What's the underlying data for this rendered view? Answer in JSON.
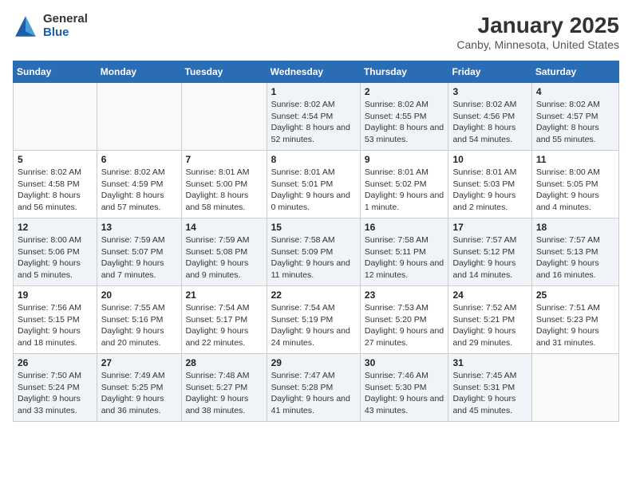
{
  "logo": {
    "general": "General",
    "blue": "Blue"
  },
  "title": "January 2025",
  "subtitle": "Canby, Minnesota, United States",
  "headers": [
    "Sunday",
    "Monday",
    "Tuesday",
    "Wednesday",
    "Thursday",
    "Friday",
    "Saturday"
  ],
  "weeks": [
    [
      {
        "day": "",
        "content": ""
      },
      {
        "day": "",
        "content": ""
      },
      {
        "day": "",
        "content": ""
      },
      {
        "day": "1",
        "content": "Sunrise: 8:02 AM\nSunset: 4:54 PM\nDaylight: 8 hours and 52 minutes."
      },
      {
        "day": "2",
        "content": "Sunrise: 8:02 AM\nSunset: 4:55 PM\nDaylight: 8 hours and 53 minutes."
      },
      {
        "day": "3",
        "content": "Sunrise: 8:02 AM\nSunset: 4:56 PM\nDaylight: 8 hours and 54 minutes."
      },
      {
        "day": "4",
        "content": "Sunrise: 8:02 AM\nSunset: 4:57 PM\nDaylight: 8 hours and 55 minutes."
      }
    ],
    [
      {
        "day": "5",
        "content": "Sunrise: 8:02 AM\nSunset: 4:58 PM\nDaylight: 8 hours and 56 minutes."
      },
      {
        "day": "6",
        "content": "Sunrise: 8:02 AM\nSunset: 4:59 PM\nDaylight: 8 hours and 57 minutes."
      },
      {
        "day": "7",
        "content": "Sunrise: 8:01 AM\nSunset: 5:00 PM\nDaylight: 8 hours and 58 minutes."
      },
      {
        "day": "8",
        "content": "Sunrise: 8:01 AM\nSunset: 5:01 PM\nDaylight: 9 hours and 0 minutes."
      },
      {
        "day": "9",
        "content": "Sunrise: 8:01 AM\nSunset: 5:02 PM\nDaylight: 9 hours and 1 minute."
      },
      {
        "day": "10",
        "content": "Sunrise: 8:01 AM\nSunset: 5:03 PM\nDaylight: 9 hours and 2 minutes."
      },
      {
        "day": "11",
        "content": "Sunrise: 8:00 AM\nSunset: 5:05 PM\nDaylight: 9 hours and 4 minutes."
      }
    ],
    [
      {
        "day": "12",
        "content": "Sunrise: 8:00 AM\nSunset: 5:06 PM\nDaylight: 9 hours and 5 minutes."
      },
      {
        "day": "13",
        "content": "Sunrise: 7:59 AM\nSunset: 5:07 PM\nDaylight: 9 hours and 7 minutes."
      },
      {
        "day": "14",
        "content": "Sunrise: 7:59 AM\nSunset: 5:08 PM\nDaylight: 9 hours and 9 minutes."
      },
      {
        "day": "15",
        "content": "Sunrise: 7:58 AM\nSunset: 5:09 PM\nDaylight: 9 hours and 11 minutes."
      },
      {
        "day": "16",
        "content": "Sunrise: 7:58 AM\nSunset: 5:11 PM\nDaylight: 9 hours and 12 minutes."
      },
      {
        "day": "17",
        "content": "Sunrise: 7:57 AM\nSunset: 5:12 PM\nDaylight: 9 hours and 14 minutes."
      },
      {
        "day": "18",
        "content": "Sunrise: 7:57 AM\nSunset: 5:13 PM\nDaylight: 9 hours and 16 minutes."
      }
    ],
    [
      {
        "day": "19",
        "content": "Sunrise: 7:56 AM\nSunset: 5:15 PM\nDaylight: 9 hours and 18 minutes."
      },
      {
        "day": "20",
        "content": "Sunrise: 7:55 AM\nSunset: 5:16 PM\nDaylight: 9 hours and 20 minutes."
      },
      {
        "day": "21",
        "content": "Sunrise: 7:54 AM\nSunset: 5:17 PM\nDaylight: 9 hours and 22 minutes."
      },
      {
        "day": "22",
        "content": "Sunrise: 7:54 AM\nSunset: 5:19 PM\nDaylight: 9 hours and 24 minutes."
      },
      {
        "day": "23",
        "content": "Sunrise: 7:53 AM\nSunset: 5:20 PM\nDaylight: 9 hours and 27 minutes."
      },
      {
        "day": "24",
        "content": "Sunrise: 7:52 AM\nSunset: 5:21 PM\nDaylight: 9 hours and 29 minutes."
      },
      {
        "day": "25",
        "content": "Sunrise: 7:51 AM\nSunset: 5:23 PM\nDaylight: 9 hours and 31 minutes."
      }
    ],
    [
      {
        "day": "26",
        "content": "Sunrise: 7:50 AM\nSunset: 5:24 PM\nDaylight: 9 hours and 33 minutes."
      },
      {
        "day": "27",
        "content": "Sunrise: 7:49 AM\nSunset: 5:25 PM\nDaylight: 9 hours and 36 minutes."
      },
      {
        "day": "28",
        "content": "Sunrise: 7:48 AM\nSunset: 5:27 PM\nDaylight: 9 hours and 38 minutes."
      },
      {
        "day": "29",
        "content": "Sunrise: 7:47 AM\nSunset: 5:28 PM\nDaylight: 9 hours and 41 minutes."
      },
      {
        "day": "30",
        "content": "Sunrise: 7:46 AM\nSunset: 5:30 PM\nDaylight: 9 hours and 43 minutes."
      },
      {
        "day": "31",
        "content": "Sunrise: 7:45 AM\nSunset: 5:31 PM\nDaylight: 9 hours and 45 minutes."
      },
      {
        "day": "",
        "content": ""
      }
    ]
  ]
}
